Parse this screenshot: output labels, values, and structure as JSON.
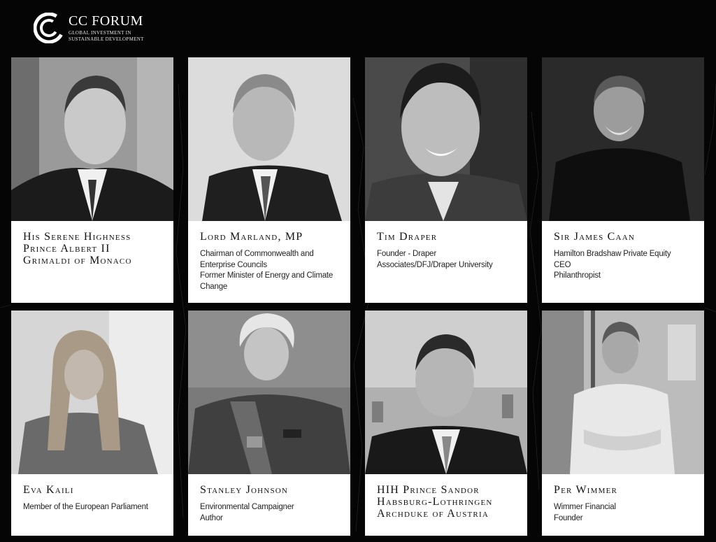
{
  "brand": {
    "title": "CC FORUM",
    "subtitle_line1": "GLOBAL INVESTMENT IN",
    "subtitle_line2": "SUSTAINABLE DEVELOPMENT",
    "colors": {
      "background": "#050505",
      "text": "#ffffff",
      "card": "#ffffff"
    }
  },
  "speakers": [
    {
      "name": "His Serene Highness\nPrince Albert II\nGrimaldi of Monaco",
      "desc": "",
      "photo_icon": "speaker-photo"
    },
    {
      "name": "Lord Marland, MP",
      "desc": "Chairman of Commonwealth and\nEnterprise Councils\nFormer Minister of Energy and Climate\nChange",
      "photo_icon": "speaker-photo"
    },
    {
      "name": "Tim Draper",
      "desc": "Founder - Draper\nAssociates/DFJ/Draper University",
      "photo_icon": "speaker-photo"
    },
    {
      "name": "Sir James Caan",
      "desc": "Hamilton Bradshaw Private Equity\nCEO\nPhilanthropist",
      "photo_icon": "speaker-photo"
    },
    {
      "name": "Eva Kaili",
      "desc": "Member of the European Parliament",
      "photo_icon": "speaker-photo"
    },
    {
      "name": "Stanley Johnson",
      "desc": "Environmental Campaigner\nAuthor",
      "photo_icon": "speaker-photo"
    },
    {
      "name": "HIH Prince Sandor\nHabsburg-Lothringen\nArchduke of Austria",
      "desc": "",
      "photo_icon": "speaker-photo"
    },
    {
      "name": "Per Wimmer",
      "desc": "Wimmer Financial\nFounder",
      "photo_icon": "speaker-photo"
    }
  ]
}
